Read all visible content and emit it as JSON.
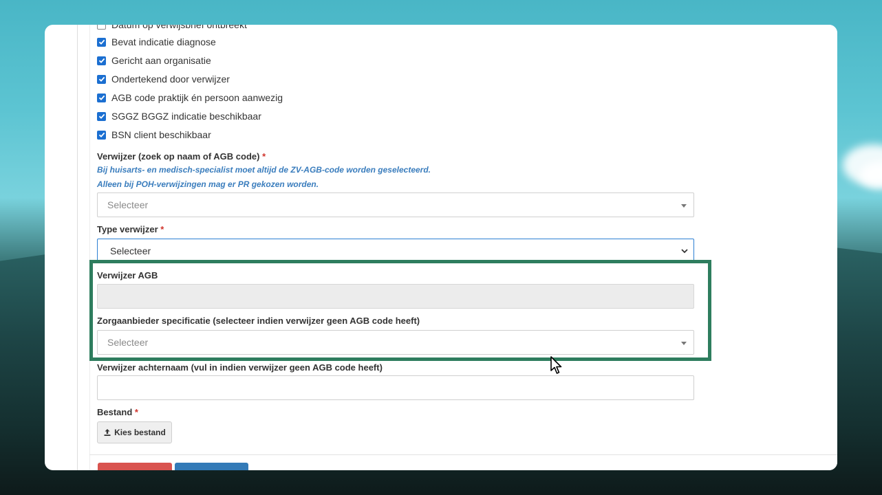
{
  "checklist": [
    {
      "label": "Datum op verwijsbrief ontbreekt",
      "checked": false
    },
    {
      "label": "Bevat indicatie diagnose",
      "checked": true
    },
    {
      "label": "Gericht aan organisatie",
      "checked": true
    },
    {
      "label": "Ondertekend door verwijzer",
      "checked": true
    },
    {
      "label": "AGB code praktijk én persoon aanwezig",
      "checked": true
    },
    {
      "label": "SGGZ BGGZ indicatie beschikbaar",
      "checked": true
    },
    {
      "label": "BSN client beschikbaar",
      "checked": true
    }
  ],
  "verwijzer": {
    "label": "Verwijzer (zoek op naam of AGB code)",
    "required_mark": "*",
    "hint1": "Bij huisarts- en medisch-specialist moet altijd de ZV-AGB-code worden geselecteerd.",
    "hint2": "Alleen bij POH-verwijzingen mag er PR gekozen worden.",
    "placeholder": "Selecteer"
  },
  "type_verwijzer": {
    "label": "Type verwijzer",
    "required_mark": "*",
    "value": "Selecteer"
  },
  "verwijzer_agb": {
    "label": "Verwijzer AGB",
    "value": ""
  },
  "zorgaanbieder": {
    "label": "Zorgaanbieder specificatie (selecteer indien verwijzer geen AGB code heeft)",
    "placeholder": "Selecteer"
  },
  "achternaam": {
    "label": "Verwijzer achternaam (vul in indien verwijzer geen AGB code heeft)",
    "value": ""
  },
  "bestand": {
    "label": "Bestand",
    "required_mark": "*",
    "button_label": "Kies bestand"
  },
  "colors": {
    "checkbox": "#1b6fd1",
    "highlight": "#2e7d5e",
    "required": "#d0342c",
    "hint": "#3a7dbd"
  }
}
